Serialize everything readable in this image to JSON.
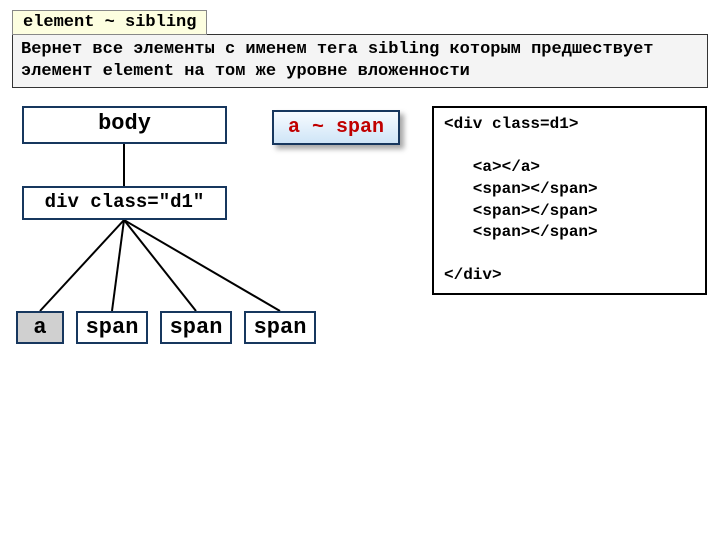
{
  "title": "element ~ sibling",
  "description": "Вернет все  элементы c именем тега sibling которым предшествует элемент element на том же уровне вложенности",
  "selectorBadge": "a ~ span",
  "tree": {
    "body": "body",
    "div": "div class=\"d1\"",
    "leaves": {
      "a": "a",
      "s1": "span",
      "s2": "span",
      "s3": "span"
    }
  },
  "code": "<div class=d1>\n\n   <a></a>\n   <span></span>\n   <span></span>\n   <span></span>\n\n</div>"
}
